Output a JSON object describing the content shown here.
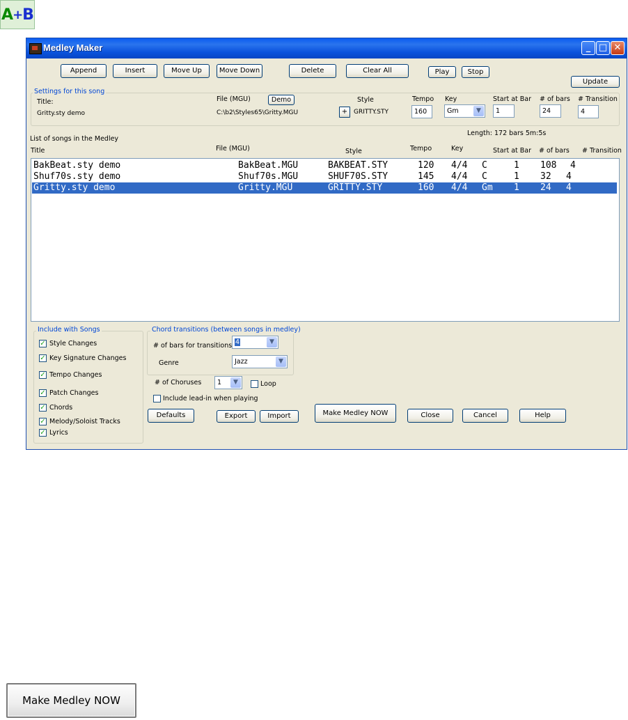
{
  "logo": {
    "a": "A",
    "plus": "+",
    "b": "B"
  },
  "window": {
    "title": "Medley Maker",
    "controls": {
      "minimize": "_",
      "maximize": "□",
      "close": "✕"
    }
  },
  "toolbar": {
    "append": "Append",
    "insert": "Insert",
    "move_up": "Move Up",
    "move_down": "Move Down",
    "delete": "Delete",
    "clear_all": "Clear All",
    "play": "Play",
    "stop": "Stop",
    "update": "Update"
  },
  "settings": {
    "legend": "Settings for this song",
    "title_label": "Title:",
    "title_value": "Gritty.sty demo",
    "file_label": "File (MGU)",
    "demo_button": "Demo",
    "file_value": "C:\\b2\\Styles65\\Gritty.MGU",
    "style_label": "Style",
    "plus_button": "+",
    "style_value": "GRITTY.STY",
    "tempo_label": "Tempo",
    "tempo_value": "160",
    "key_label": "Key",
    "key_value": "Gm",
    "start_label": "Start at Bar",
    "start_value": "1",
    "bars_label": "# of bars",
    "bars_value": "24",
    "transition_label": "# Transition",
    "transition_value": "4"
  },
  "list": {
    "caption": "List of songs in the Medley",
    "length": "Length:  172 bars  5m:5s",
    "headers": [
      "Title",
      "File (MGU)",
      "Style",
      "Tempo",
      "Key",
      "Start at Bar",
      "# of bars",
      "# Transition"
    ],
    "rows": [
      {
        "title": "BakBeat.sty demo",
        "file": "BakBeat.MGU",
        "style": "BAKBEAT.STY",
        "tempo": "120",
        "time": "4/4",
        "key": "C",
        "start": "1",
        "bars": "108",
        "transition": "4"
      },
      {
        "title": "Shuf70s.sty demo",
        "file": "Shuf70s.MGU",
        "style": "SHUF70S.STY",
        "tempo": "145",
        "time": "4/4",
        "key": "C",
        "start": "1",
        "bars": "32",
        "transition": "4"
      },
      {
        "title": "Gritty.sty demo",
        "file": "Gritty.MGU",
        "style": "GRITTY.STY",
        "tempo": "160",
        "time": "4/4",
        "key": "Gm",
        "start": "1",
        "bars": "24",
        "transition": "4"
      }
    ]
  },
  "include": {
    "legend": "Include with Songs",
    "items": [
      "Style Changes",
      "Key Signature Changes",
      "Tempo Changes",
      "Patch Changes",
      "Chords",
      "Melody/Soloist Tracks",
      "Lyrics"
    ]
  },
  "chord_transitions": {
    "legend": "Chord transitions (between songs in medley)",
    "bars_label": "# of bars for transitions",
    "bars_value": "4",
    "genre_label": "Genre",
    "genre_value": "Jazz"
  },
  "options": {
    "choruses_label": "# of Choruses",
    "choruses_value": "1",
    "loop_label": "Loop",
    "leadin_label": "Include lead-in when playing"
  },
  "bottom": {
    "defaults": "Defaults",
    "export": "Export",
    "import": "Import",
    "make": "Make Medley NOW",
    "close": "Close",
    "cancel": "Cancel",
    "help": "Help"
  },
  "big_button": {
    "label": "Make Medley NOW"
  },
  "colors": {
    "selection": "#316ac5",
    "titlebar": "#0a52dc",
    "group_legend": "#0046d5",
    "dialog_bg": "#ece9d8"
  }
}
